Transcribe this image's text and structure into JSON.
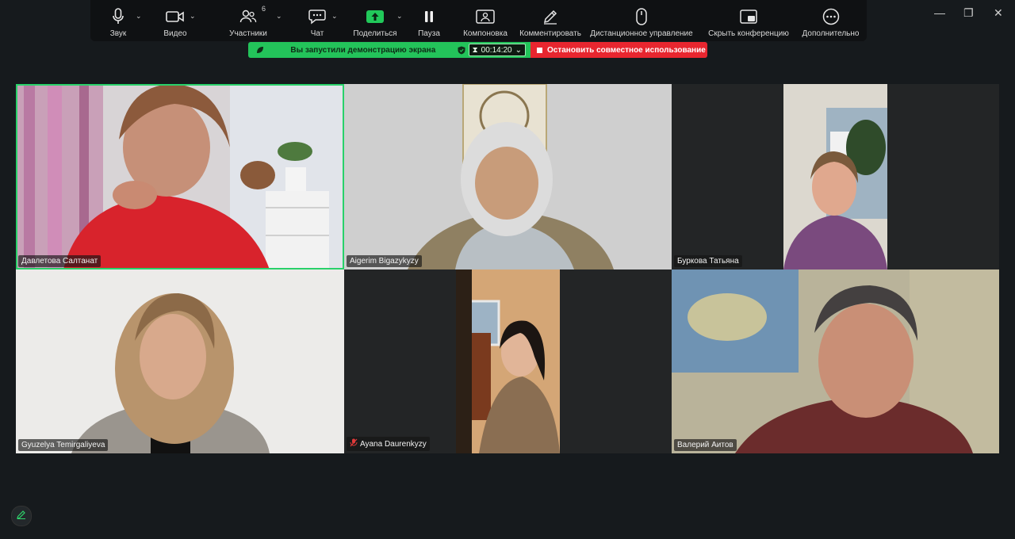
{
  "toolbar": {
    "audio": "Звук",
    "video": "Видео",
    "participants": "Участники",
    "participants_count": "6",
    "chat": "Чат",
    "share": "Поделиться",
    "pause": "Пауза",
    "layout": "Компоновка",
    "annotate": "Комментировать",
    "remote_control": "Дистанционное управление",
    "hide_meeting": "Скрыть конференцию",
    "more": "Дополнительно"
  },
  "share_banner": {
    "message": "Вы запустили демонстрацию экрана",
    "timer": "00:14:20",
    "stop": "Остановить совместное использование"
  },
  "window_controls": {
    "minimize": "—",
    "restore": "❐",
    "close": "✕"
  },
  "participants": [
    {
      "name": "Давлетова Салтанат",
      "active": true,
      "muted": false
    },
    {
      "name": "Aigerim Bigazykyzy",
      "active": false,
      "muted": false
    },
    {
      "name": "Буркова Татьяна",
      "active": false,
      "muted": false
    },
    {
      "name": "Gyuzelya Temirgaliyeva",
      "active": false,
      "muted": false
    },
    {
      "name": "Ayana Daurenkyzy",
      "active": false,
      "muted": true
    },
    {
      "name": "Валерий Аитов",
      "active": false,
      "muted": false
    }
  ],
  "colors": {
    "accent_green": "#23c35a",
    "stop_red": "#e8262f",
    "background": "#161a1d",
    "toolbar": "#0f1113"
  }
}
